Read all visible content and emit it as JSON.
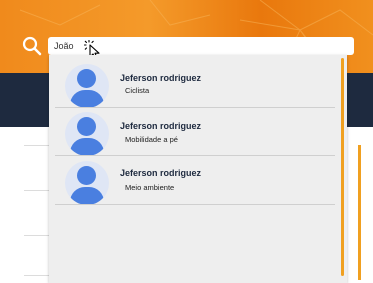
{
  "search": {
    "value": "João",
    "icon": "search-icon"
  },
  "results": [
    {
      "name": "Jeferson rodriguez",
      "role": "Ciclista"
    },
    {
      "name": "Jeferson rodriguez",
      "role": "Mobilidade a pé"
    },
    {
      "name": "Jeferson rodriguez",
      "role": "Meio ambiente"
    }
  ],
  "colors": {
    "header_orange": "#f08a1c",
    "nav_dark": "#1e2a3f",
    "accent": "#f0a020",
    "avatar_blue": "#4a7fe0"
  }
}
